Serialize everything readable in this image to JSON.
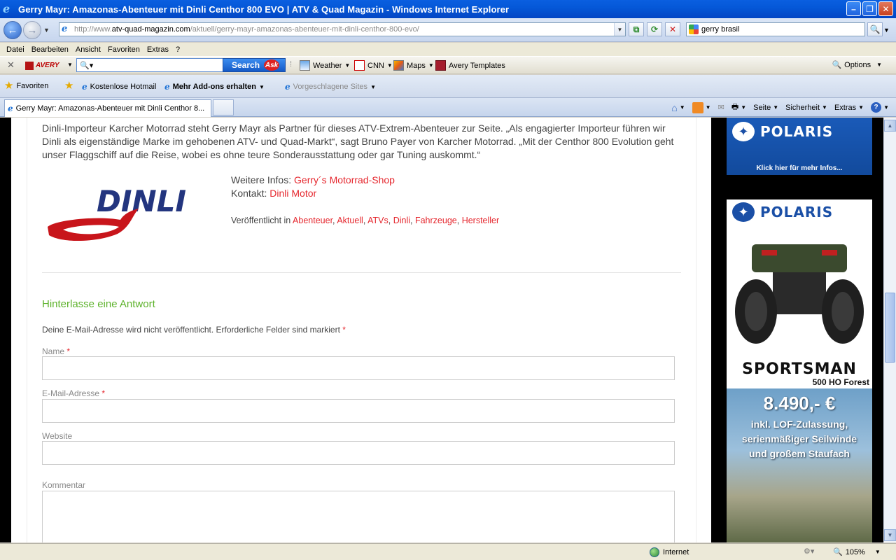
{
  "window": {
    "title": "Gerry Mayr: Amazonas-Abenteuer mit Dinli Centhor 800 EVO | ATV & Quad Magazin - Windows Internet Explorer"
  },
  "address": {
    "url_domain_prefix": "http://www.",
    "url_domain": "atv-quad-magazin.com",
    "url_path": "/aktuell/gerry-mayr-amazonas-abenteuer-mit-dinli-centhor-800-evo/",
    "search_value": "gerry brasil"
  },
  "menu": [
    "Datei",
    "Bearbeiten",
    "Ansicht",
    "Favoriten",
    "Extras",
    "?"
  ],
  "avery_toolbar": {
    "logo": "AVERY",
    "search_label": "Search",
    "ask": "Ask",
    "items": [
      "Weather",
      "CNN",
      "Maps",
      "Avery Templates"
    ],
    "options": "Options"
  },
  "favorites_bar": {
    "favorites": "Favoriten",
    "items": [
      "Kostenlose Hotmail",
      "Mehr Add-ons erhalten",
      "Vorgeschlagene Sites"
    ]
  },
  "tab": {
    "title": "Gerry Mayr: Amazonas-Abenteuer mit Dinli Centhor 8..."
  },
  "command_bar": {
    "page": "Seite",
    "security": "Sicherheit",
    "extras": "Extras"
  },
  "article": {
    "paragraph": "Dinli-Importeur Karcher Motorrad steht Gerry Mayr als Partner für dieses ATV-Extrem-Abenteuer zur Seite. „Als engagierter Importeur führen wir Dinli als eigenständige Marke im gehobenen ATV- und Quad-Markt“, sagt Bruno Payer von Karcher Motorrad. „Mit der Centhor 800 Evolution geht unser Flaggschiff auf die Reise, wobei es ohne teure Sonderausstattung oder gar Tuning auskommt.“",
    "logo_text": "DINLI",
    "more_info_label": "Weitere Infos:",
    "more_info_link": "Gerry´s Motorrad-Shop",
    "contact_label": "Kontakt:",
    "contact_link": "Dinli Motor",
    "published_label": "Veröffentlicht in",
    "categories": [
      "Abenteuer",
      "Aktuell",
      "ATVs",
      "Dinli",
      "Fahrzeuge",
      "Hersteller"
    ]
  },
  "comment_form": {
    "title": "Hinterlasse eine Antwort",
    "notice": "Deine E-Mail-Adresse wird nicht veröffentlicht. Erforderliche Felder sind markiert",
    "required_mark": "*",
    "name_label": "Name",
    "email_label": "E-Mail-Adresse",
    "website_label": "Website",
    "comment_label": "Kommentar"
  },
  "ads": {
    "brand": "POLARIS",
    "ad1_cta": "Klick hier für mehr Infos...",
    "model": "SPORTSMAN",
    "model_sub": "500 HO Forest",
    "price": "8.490,- €",
    "offer_lines": [
      "inkl. LOF-Zulassung,",
      "serienmäßiger Seilwinde",
      "und großem Staufach"
    ]
  },
  "status_bar": {
    "zone": "Internet",
    "zoom": "105%"
  },
  "colors": {
    "link_red": "#e5262d",
    "reply_green": "#5db22b",
    "polaris_blue": "#1a4fa6"
  }
}
